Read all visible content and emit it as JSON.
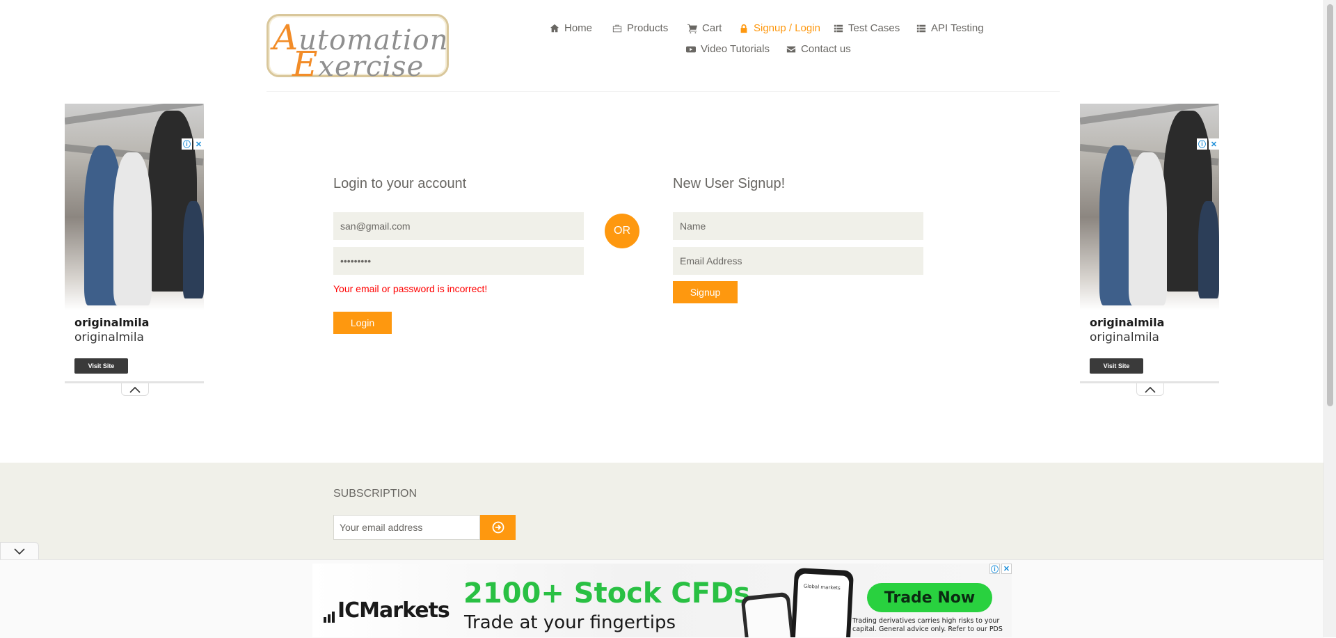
{
  "logo": {
    "line1_cap": "A",
    "line1_rest": "utomation",
    "line2_cap": "E",
    "line2_rest": "xercise"
  },
  "nav": {
    "items": [
      {
        "label": "Home",
        "icon": "home-icon"
      },
      {
        "label": "Products",
        "icon": "products-icon"
      },
      {
        "label": "Cart",
        "icon": "cart-icon"
      },
      {
        "label": "Signup / Login",
        "icon": "lock-icon",
        "active": true
      },
      {
        "label": "Test Cases",
        "icon": "list-icon"
      },
      {
        "label": "API Testing",
        "icon": "list-icon"
      },
      {
        "label": "Video Tutorials",
        "icon": "youtube-icon"
      },
      {
        "label": "Contact us",
        "icon": "envelope-icon"
      }
    ]
  },
  "side_ads": {
    "brand_bold": "originalmila",
    "brand": "originalmila",
    "visit_label": "Visit Site",
    "info_glyph": "ⓘ",
    "close_glyph": "✕"
  },
  "login": {
    "title": "Login to your account",
    "email_value": "san@gmail.com",
    "password_value": "•••••••••",
    "error": "Your email or password is incorrect!",
    "button": "Login"
  },
  "or_label": "OR",
  "signup": {
    "title": "New User Signup!",
    "name_placeholder": "Name",
    "email_placeholder": "Email Address",
    "button": "Signup"
  },
  "subscription": {
    "title": "SUBSCRIPTION",
    "placeholder": "Your email address"
  },
  "bottom_ad": {
    "brand": "ICMarkets",
    "headline": "2100+ Stock CFDs",
    "tagline": "Trade at your fingertips",
    "cta": "Trade Now",
    "disclaimer": "Trading derivatives carries high risks to your capital. General advice only. Refer to our PDS",
    "phone_text": "Global markets"
  },
  "colors": {
    "accent": "#fe980f",
    "error": "#ff0000",
    "field_bg": "#f0f0e9",
    "ad_green": "#29c043"
  }
}
